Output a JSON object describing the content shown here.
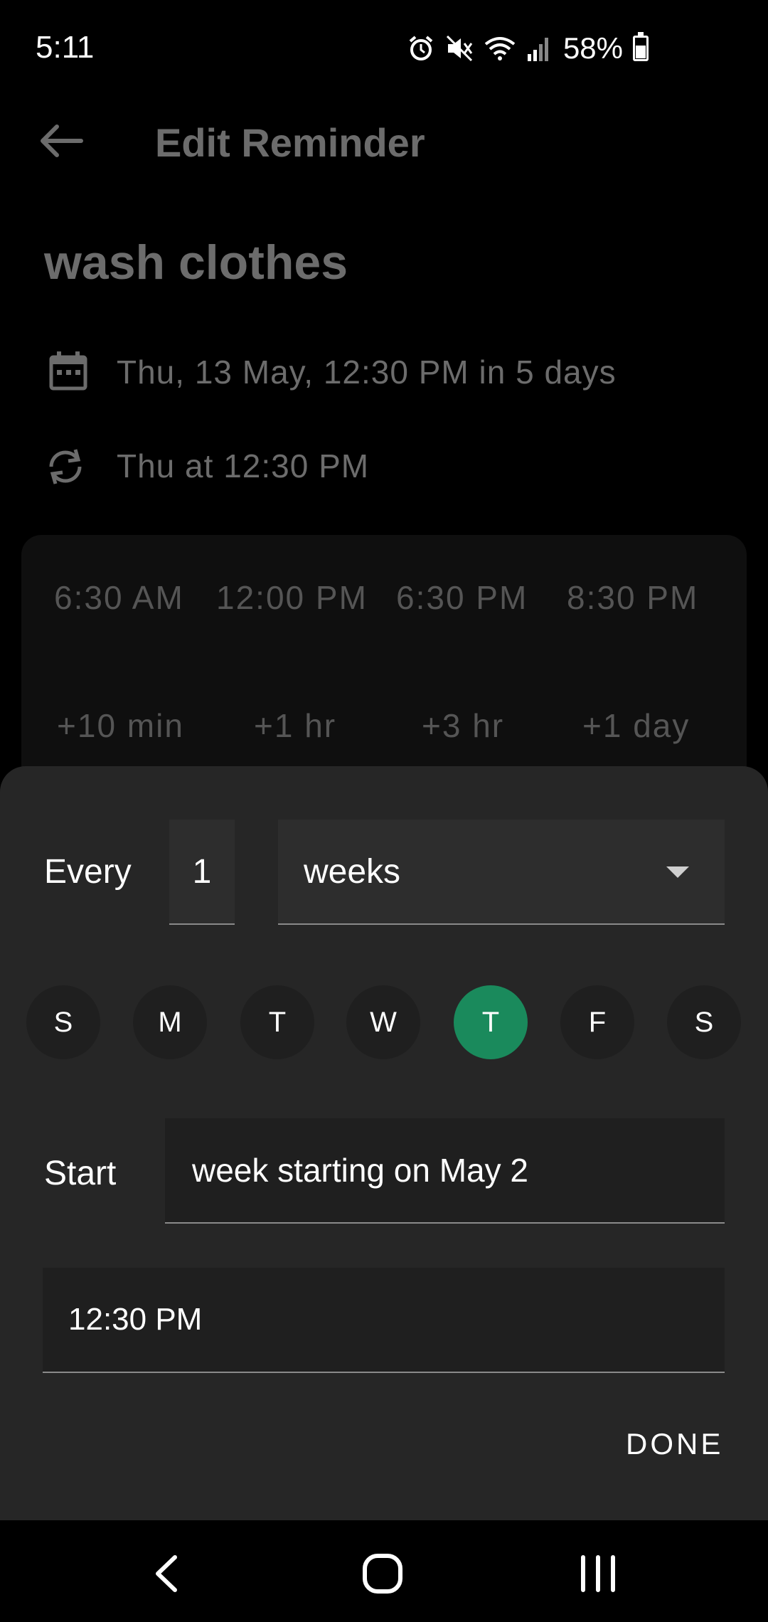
{
  "status_bar": {
    "time": "5:11",
    "battery_percent": "58%",
    "battery_level": 0.58,
    "icons": [
      "alarm-icon",
      "mute-icon",
      "wifi-icon",
      "signal-icon",
      "battery-icon"
    ]
  },
  "toolbar": {
    "title": "Edit Reminder",
    "back_icon": "arrow-left-icon"
  },
  "reminder": {
    "title": "wash clothes",
    "date_text": "Thu, 13 May, 12:30 PM in 5 days",
    "repeat_text": "Thu at 12:30 PM"
  },
  "quick_times": [
    "6:30 AM",
    "12:00 PM",
    "6:30 PM",
    "8:30 PM"
  ],
  "quick_adds": [
    "+10 min",
    "+1 hr",
    "+3 hr",
    "+1 day"
  ],
  "recurrence": {
    "every_label": "Every",
    "interval": "1",
    "unit": "weeks",
    "days": [
      {
        "label": "S",
        "selected": false
      },
      {
        "label": "M",
        "selected": false
      },
      {
        "label": "T",
        "selected": false
      },
      {
        "label": "W",
        "selected": false
      },
      {
        "label": "T",
        "selected": true
      },
      {
        "label": "F",
        "selected": false
      },
      {
        "label": "S",
        "selected": false
      }
    ],
    "start_label": "Start",
    "start_value": "week starting on May 2",
    "time_value": "12:30 PM",
    "done_label": "DONE"
  },
  "colors": {
    "selected_day": "#1a8a5c",
    "sheet_bg": "#262626"
  }
}
